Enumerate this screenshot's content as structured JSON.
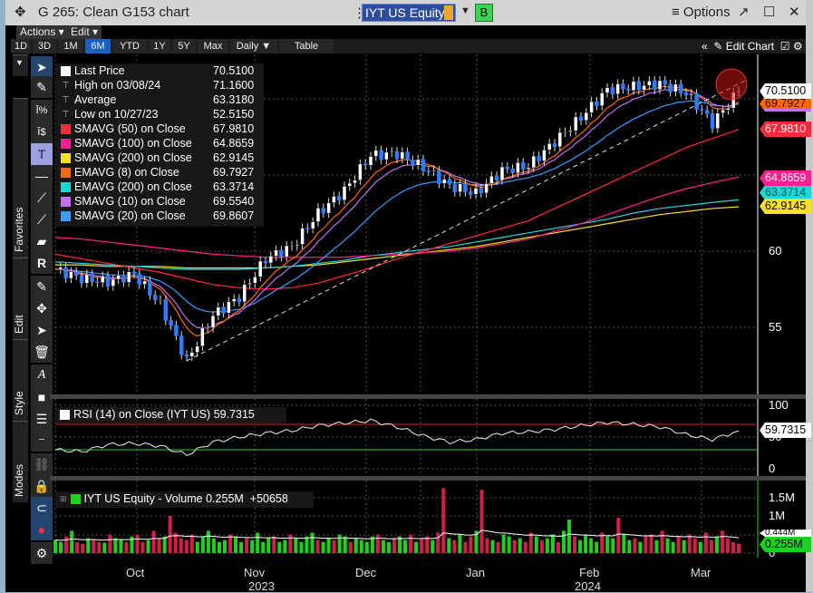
{
  "window": {
    "title": "G 265: Clean G153 chart",
    "ticker": "IYT US Equity",
    "b_label": "B",
    "options_label": "Options"
  },
  "menu": {
    "actions": "Actions ▾",
    "edit": "Edit ▾"
  },
  "tabs": [
    "1D",
    "3D",
    "1M",
    "6M",
    "YTD",
    "1Y",
    "5Y",
    "Max",
    "Daily ▼",
    "Table"
  ],
  "active_tab": "6M",
  "edit_chart": "Edit Chart",
  "toolbar_sections": {
    "favorites": "Favorites",
    "edit": "Edit",
    "style": "Style",
    "modes": "Modes"
  },
  "legend": [
    {
      "label": "Last Price",
      "value": "70.5100",
      "color": "#ffffff"
    },
    {
      "label": "High on 03/08/24",
      "value": "71.1600",
      "color": "none"
    },
    {
      "label": "Average",
      "value": "63.3180",
      "color": "none"
    },
    {
      "label": "Low on 10/27/23",
      "value": "52.5150",
      "color": "none"
    },
    {
      "label": "SMAVG (50)  on Close",
      "value": "67.9810",
      "color": "#ff2a3a"
    },
    {
      "label": "SMAVG (100)  on Close",
      "value": "64.8659",
      "color": "#ff1f8f"
    },
    {
      "label": "SMAVG (200)  on Close",
      "value": "62.9145",
      "color": "#ffe020"
    },
    {
      "label": "EMAVG (8)  on Close",
      "value": "69.7927",
      "color": "#ff6a00"
    },
    {
      "label": "EMAVG (200)  on Close",
      "value": "63.3714",
      "color": "#1fd6d6"
    },
    {
      "label": "SMAVG (10)  on Close",
      "value": "69.5540",
      "color": "#c070f0"
    },
    {
      "label": "SMAVG (20)  on Close",
      "value": "69.8607",
      "color": "#3a9cff"
    }
  ],
  "rsi": {
    "label": "RSI (14)  on Close (IYT US)",
    "value": "59.7315"
  },
  "volume": {
    "label": "IYT US Equity  - Volume",
    "value": "0.255M",
    "change": "+50658"
  },
  "right_labels": {
    "last": "70.5100",
    "ema8": "69.7927",
    "sma50": "67.9810",
    "sma100": "64.8659",
    "sma200": "62.9145",
    "ema200": "63.3714",
    "rsi": "59.7315",
    "vol": "0.255M",
    "vol_ma": "0.444M"
  },
  "chart_data": {
    "type": "candlestick",
    "price_axis": {
      "ticks": [
        55,
        60
      ],
      "range": [
        50.5,
        72.8
      ]
    },
    "rsi_axis": {
      "ticks": [
        "100",
        "50",
        "0"
      ],
      "range": [
        0,
        100
      ],
      "levels": [
        70,
        30
      ]
    },
    "volume_axis": {
      "ticks": [
        "1.5M",
        "1M",
        "0"
      ],
      "range": [
        0,
        1.9
      ]
    },
    "x_labels": [
      "Oct",
      "Nov",
      "Dec",
      "Jan",
      "Feb",
      "Mar"
    ],
    "year_labels": [
      "2023",
      "2024"
    ],
    "weekly_close": [
      58.8,
      58.2,
      58.0,
      58.5,
      56.5,
      52.8,
      55.8,
      57.0,
      59.5,
      60.3,
      62.5,
      64.0,
      66.3,
      66.4,
      65.5,
      64.3,
      63.8,
      65.3,
      65.6,
      67.2,
      68.8,
      70.6,
      70.8,
      71.0,
      70.4,
      68.4,
      70.51
    ],
    "sma50": [
      59.8,
      59.5,
      59.2,
      58.9,
      58.6,
      58.2,
      57.8,
      57.6,
      57.5,
      57.6,
      57.9,
      58.4,
      58.9,
      59.5,
      60.0,
      60.5,
      61.0,
      61.5,
      62.0,
      62.8,
      63.6,
      64.4,
      65.2,
      66.0,
      66.8,
      67.4,
      67.98
    ],
    "sma100": [
      60.9,
      60.8,
      60.6,
      60.4,
      60.2,
      60.0,
      59.8,
      59.7,
      59.6,
      59.6,
      59.6,
      59.6,
      59.7,
      59.8,
      59.9,
      60.0,
      60.2,
      60.5,
      60.8,
      61.3,
      61.8,
      62.4,
      63.0,
      63.6,
      64.1,
      64.5,
      64.87
    ],
    "sma200": [
      59.1,
      59.1,
      59.0,
      59.0,
      59.0,
      58.9,
      58.9,
      58.9,
      58.9,
      59.0,
      59.1,
      59.3,
      59.5,
      59.7,
      59.9,
      60.1,
      60.3,
      60.6,
      60.9,
      61.2,
      61.5,
      61.8,
      62.1,
      62.4,
      62.6,
      62.8,
      62.91
    ],
    "ema200": [
      59.3,
      59.2,
      59.1,
      59.0,
      58.9,
      58.8,
      58.8,
      58.8,
      58.9,
      59.0,
      59.2,
      59.4,
      59.7,
      59.9,
      60.1,
      60.3,
      60.6,
      60.9,
      61.2,
      61.5,
      61.8,
      62.1,
      62.5,
      62.8,
      63.0,
      63.2,
      63.37
    ],
    "rsi_weekly": [
      30,
      27,
      38,
      40,
      36,
      22,
      42,
      50,
      56,
      60,
      68,
      72,
      76,
      66,
      52,
      42,
      46,
      56,
      58,
      62,
      68,
      73,
      70,
      66,
      54,
      46,
      59.73
    ],
    "volume_m": [
      0.35,
      0.3,
      0.45,
      0.6,
      0.3,
      0.25,
      0.4,
      0.35,
      0.3,
      0.28,
      0.5,
      0.4,
      0.35,
      0.3,
      0.45,
      0.5,
      0.3,
      0.35,
      0.6,
      0.4,
      0.45,
      1.0,
      0.55,
      0.4,
      0.35,
      0.5,
      0.3,
      0.45,
      0.6,
      0.4,
      0.3,
      0.35,
      0.5,
      0.45,
      0.3,
      0.4,
      0.35,
      0.55,
      0.3,
      0.4,
      0.45,
      0.3,
      0.35,
      0.5,
      0.4,
      0.3,
      0.45,
      0.55,
      0.35,
      0.3,
      0.4,
      0.35,
      0.5,
      0.45,
      0.3,
      0.4,
      0.35,
      0.3,
      0.45,
      0.5,
      0.35,
      0.3,
      0.4,
      0.45,
      0.35,
      0.5,
      0.3,
      0.4,
      0.45,
      0.35,
      0.55,
      1.75,
      0.4,
      0.35,
      0.5,
      0.3,
      0.45,
      0.6,
      1.7,
      0.4,
      0.35,
      0.3,
      0.5,
      0.45,
      0.35,
      0.4,
      0.3,
      0.55,
      0.45,
      0.35,
      0.4,
      0.5,
      0.3,
      0.6,
      0.9,
      0.45,
      0.35,
      0.5,
      0.4,
      0.3,
      0.55,
      0.45,
      0.4,
      0.95,
      0.5,
      0.35,
      0.4,
      0.3,
      0.45,
      0.5,
      0.35,
      0.6,
      0.4,
      0.3,
      0.45,
      0.35,
      0.5,
      0.4,
      0.3,
      0.55,
      0.35,
      0.45,
      0.6,
      0.4,
      0.3,
      0.255
    ]
  }
}
